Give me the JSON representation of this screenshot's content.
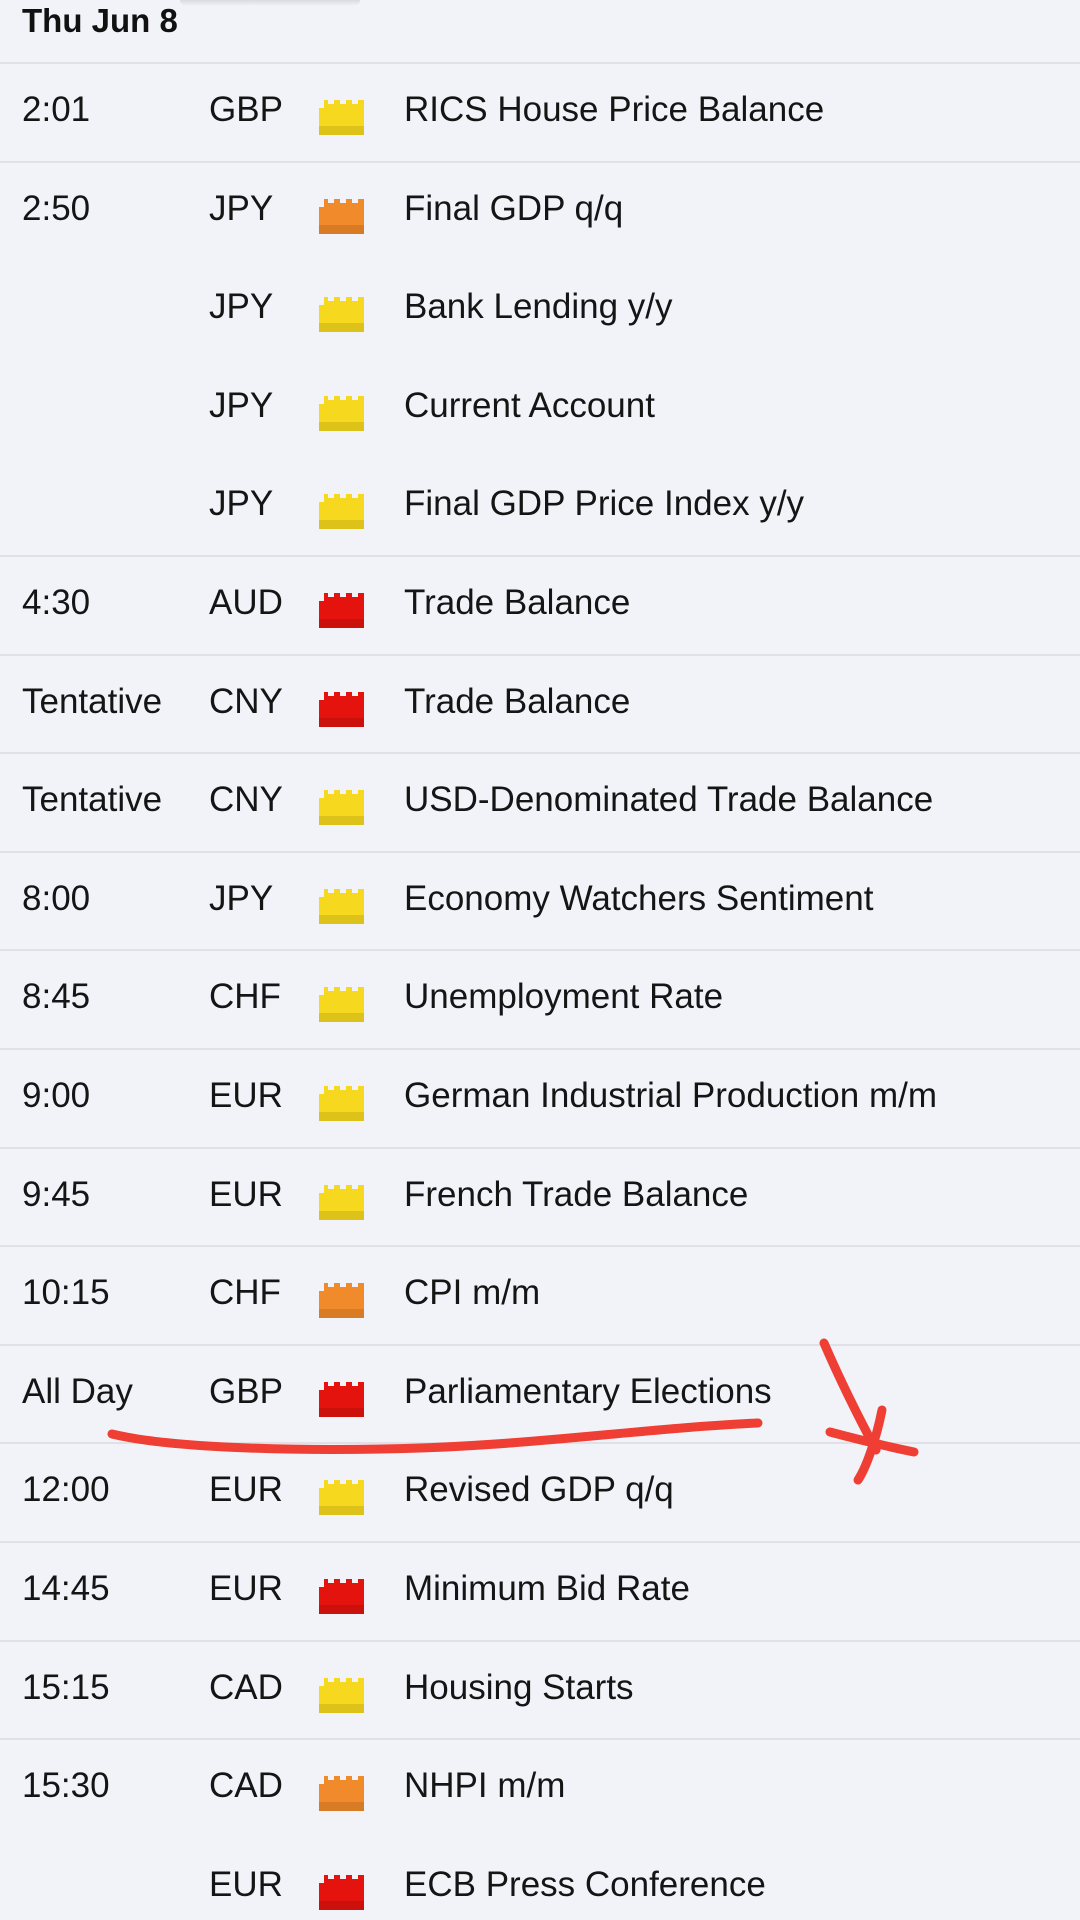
{
  "day_header": "Thu Jun 8",
  "colors": {
    "low": "#f6d81e",
    "medium": "#f08a2a",
    "high": "#e4130e",
    "annotation": "#ef3e33"
  },
  "events": [
    {
      "time": "2:01",
      "currency": "GBP",
      "impact": "low",
      "icon": "low-impact-icon",
      "name": "RICS House Price Balance",
      "sep": true
    },
    {
      "time": "2:50",
      "currency": "JPY",
      "impact": "medium",
      "icon": "medium-impact-icon",
      "name": "Final GDP q/q",
      "sep": false
    },
    {
      "time": "",
      "currency": "JPY",
      "impact": "low",
      "icon": "low-impact-icon",
      "name": "Bank Lending y/y",
      "sep": false
    },
    {
      "time": "",
      "currency": "JPY",
      "impact": "low",
      "icon": "low-impact-icon",
      "name": "Current Account",
      "sep": false
    },
    {
      "time": "",
      "currency": "JPY",
      "impact": "low",
      "icon": "low-impact-icon",
      "name": "Final GDP Price Index y/y",
      "sep": true
    },
    {
      "time": "4:30",
      "currency": "AUD",
      "impact": "high",
      "icon": "high-impact-icon",
      "name": "Trade Balance",
      "sep": true
    },
    {
      "time": "Tentative",
      "currency": "CNY",
      "impact": "high",
      "icon": "high-impact-icon",
      "name": "Trade Balance",
      "sep": true
    },
    {
      "time": "Tentative",
      "currency": "CNY",
      "impact": "low",
      "icon": "low-impact-icon",
      "name": "USD-Denominated Trade Balance",
      "sep": true
    },
    {
      "time": "8:00",
      "currency": "JPY",
      "impact": "low",
      "icon": "low-impact-icon",
      "name": "Economy Watchers Sentiment",
      "sep": true
    },
    {
      "time": "8:45",
      "currency": "CHF",
      "impact": "low",
      "icon": "low-impact-icon",
      "name": "Unemployment Rate",
      "sep": true
    },
    {
      "time": "9:00",
      "currency": "EUR",
      "impact": "low",
      "icon": "low-impact-icon",
      "name": "German Industrial Production m/m",
      "sep": true
    },
    {
      "time": "9:45",
      "currency": "EUR",
      "impact": "low",
      "icon": "low-impact-icon",
      "name": "French Trade Balance",
      "sep": true
    },
    {
      "time": "10:15",
      "currency": "CHF",
      "impact": "medium",
      "icon": "medium-impact-icon",
      "name": "CPI m/m",
      "sep": true
    },
    {
      "time": "All Day",
      "currency": "GBP",
      "impact": "high",
      "icon": "high-impact-icon",
      "name": "Parliamentary Elections",
      "sep": true
    },
    {
      "time": "12:00",
      "currency": "EUR",
      "impact": "low",
      "icon": "low-impact-icon",
      "name": "Revised GDP q/q",
      "sep": true
    },
    {
      "time": "14:45",
      "currency": "EUR",
      "impact": "high",
      "icon": "high-impact-icon",
      "name": "Minimum Bid Rate",
      "sep": true
    },
    {
      "time": "15:15",
      "currency": "CAD",
      "impact": "low",
      "icon": "low-impact-icon",
      "name": "Housing Starts",
      "sep": true
    },
    {
      "time": "15:30",
      "currency": "CAD",
      "impact": "medium",
      "icon": "medium-impact-icon",
      "name": "NHPI m/m",
      "sep": false
    },
    {
      "time": "",
      "currency": "EUR",
      "impact": "high",
      "icon": "high-impact-icon",
      "name": "ECB Press Conference",
      "sep": false
    }
  ],
  "annotation": {
    "underline_icon": "handwritten-underline-icon",
    "mark_icon": "handwritten-x-mark-icon"
  }
}
